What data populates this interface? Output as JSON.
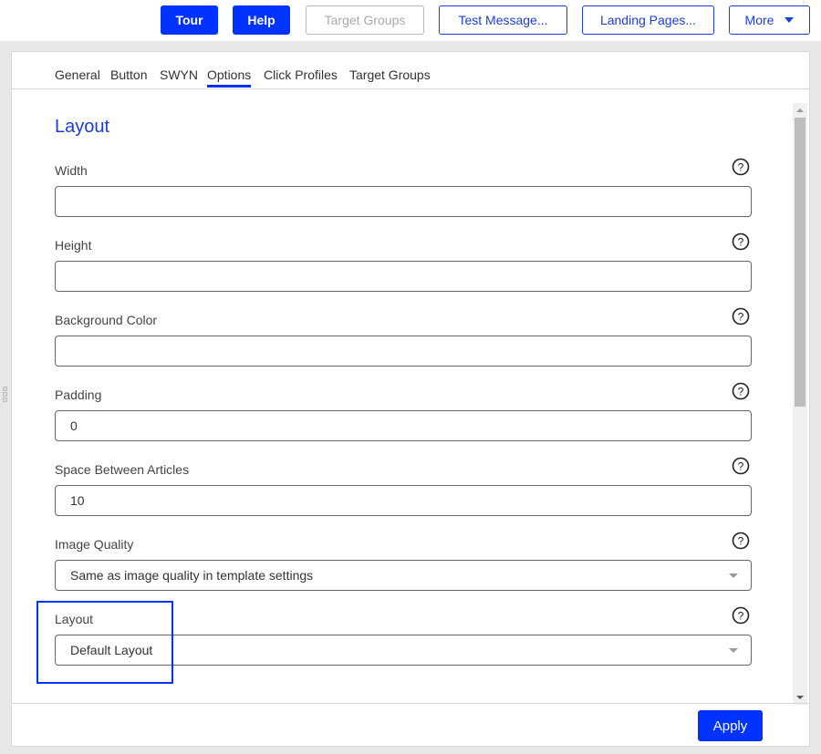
{
  "toolbar": {
    "buttons": [
      {
        "label": "Tour",
        "style": "primary"
      },
      {
        "label": "Help",
        "style": "primary"
      },
      {
        "label": "Target Groups",
        "style": "disabled"
      },
      {
        "label": "Test Message...",
        "style": "outline"
      },
      {
        "label": "Landing Pages...",
        "style": "outline"
      },
      {
        "label": "More",
        "style": "outline",
        "has_dropdown": true
      }
    ]
  },
  "tabs": [
    {
      "label": "General",
      "active": false
    },
    {
      "label": "Button",
      "active": false
    },
    {
      "label": "SWYN",
      "active": false
    },
    {
      "label": "Options",
      "active": true
    },
    {
      "label": "Click Profiles",
      "active": false
    },
    {
      "label": "Target Groups",
      "active": false
    }
  ],
  "section": {
    "title": "Layout"
  },
  "fields": [
    {
      "label": "Width",
      "type": "text",
      "value": ""
    },
    {
      "label": "Height",
      "type": "text",
      "value": ""
    },
    {
      "label": "Background Color",
      "type": "text",
      "value": ""
    },
    {
      "label": "Padding",
      "type": "text",
      "value": "0"
    },
    {
      "label": "Space Between Articles",
      "type": "text",
      "value": "10"
    },
    {
      "label": "Image Quality",
      "type": "select",
      "value": "Same as image quality in template settings"
    },
    {
      "label": "Layout",
      "type": "select",
      "value": "Default Layout"
    }
  ],
  "footer": {
    "apply_label": "Apply"
  },
  "colors": {
    "accent": "#0033ff",
    "outline": "#1a3fd6",
    "heading": "#1a3fd6"
  }
}
